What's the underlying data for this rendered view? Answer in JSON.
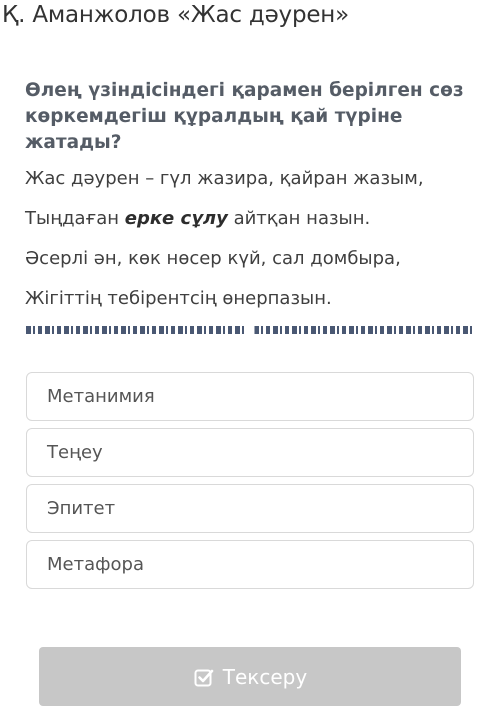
{
  "header": {
    "title": "Қ. Аманжолов «Жас дәурен»"
  },
  "question": {
    "text": "Өлең үзіндісіндегі қарамен берілген сөз көркемдегіш құралдың қай түріне жатады?"
  },
  "poem": {
    "line1": "Жас дәурен – гүл жазира, қайран жазым,",
    "line2_before": "Тыңдаған ",
    "line2_bold": "ерке сұлу",
    "line2_after": " айтқан назын.",
    "line3": "Әсерлі ән, көк нөсер күй, сал домбыра,",
    "line4": "Жігіттің тебірентсің өнерпазын."
  },
  "options": [
    {
      "label": "Метанимия"
    },
    {
      "label": "Теңеу"
    },
    {
      "label": "Эпитет"
    },
    {
      "label": "Метафора"
    }
  ],
  "submit": {
    "label": "Тексеру",
    "icon": "check-square-icon"
  },
  "colors": {
    "button_bg": "#c7c7c7",
    "option_border": "#d9d9d9",
    "question_text": "#555c66"
  }
}
